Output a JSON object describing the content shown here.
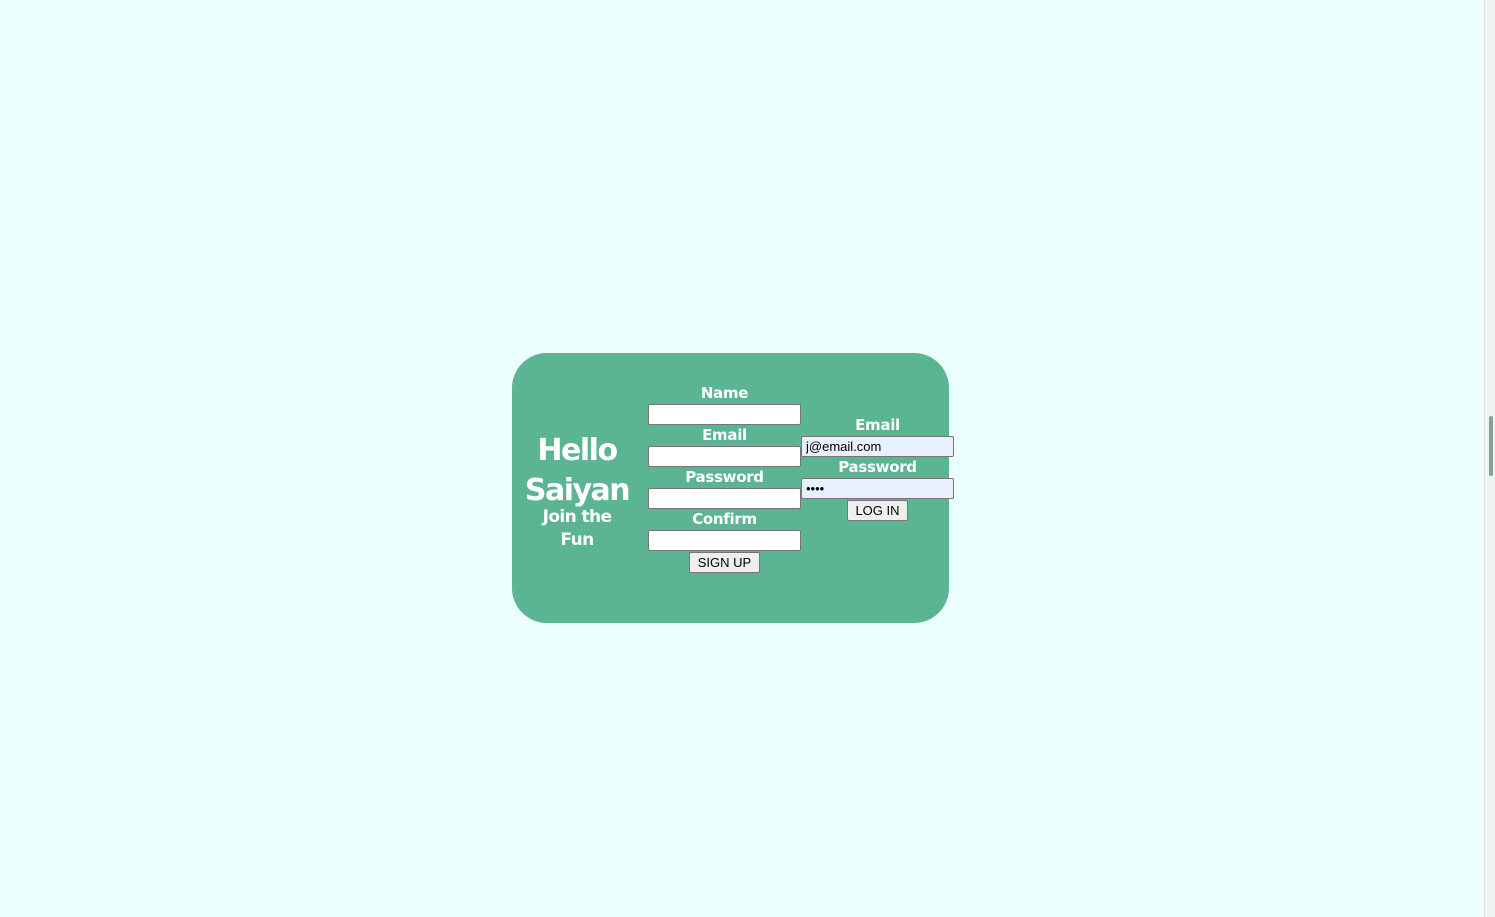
{
  "page": {
    "background_color": "#ebffff",
    "card_color": "#5bb592"
  },
  "greeting": {
    "title_line1": "Hello",
    "title_line2": "Saiyan",
    "subtitle_line1": "Join the",
    "subtitle_line2": "Fun"
  },
  "signup": {
    "name_label": "Name",
    "name_value": "",
    "email_label": "Email",
    "email_value": "",
    "password_label": "Password",
    "password_value": "",
    "confirm_label": "Confirm",
    "confirm_value": "",
    "submit_label": "SIGN UP"
  },
  "login": {
    "email_label": "Email",
    "email_value": "j@email.com",
    "password_label": "Password",
    "password_value": "1234",
    "submit_label": "LOG IN"
  }
}
